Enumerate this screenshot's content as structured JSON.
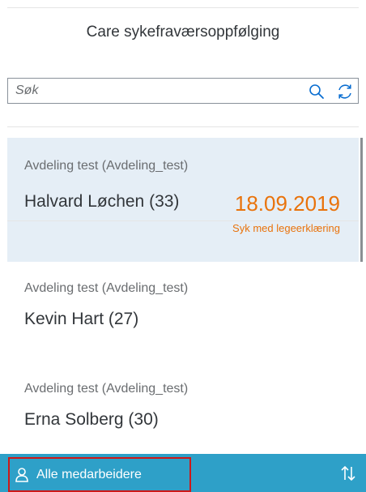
{
  "header": {
    "title": "Care sykefraværsoppfølging"
  },
  "search": {
    "placeholder": "Søk",
    "search_icon": "search-icon",
    "refresh_icon": "refresh-icon"
  },
  "list": {
    "items": [
      {
        "department": "Avdeling test (Avdeling_test)",
        "name": "Halvard Løchen (33)",
        "date": "18.09.2019",
        "status": "Syk med legeerklæring",
        "selected": true
      },
      {
        "department": "Avdeling test (Avdeling_test)",
        "name": "Kevin Hart (27)"
      },
      {
        "department": "Avdeling test (Avdeling_test)",
        "name": "Erna Solberg (30)"
      }
    ]
  },
  "footer": {
    "filter_label": "Alle medarbeidere",
    "filter_icon": "person-icon",
    "sort_icon": "sort-icon"
  },
  "colors": {
    "accent": "#e9730c",
    "footer_bg": "#2ea0c8",
    "selected_bg": "#e5eef6",
    "highlight_border": "#cc1919"
  }
}
